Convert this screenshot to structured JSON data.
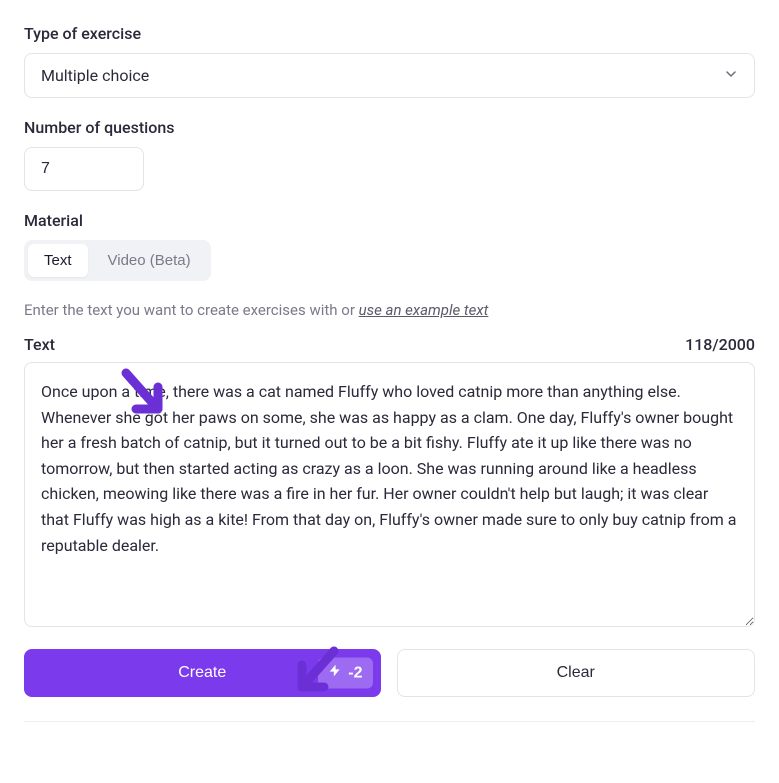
{
  "exercise_type": {
    "label": "Type of exercise",
    "value": "Multiple choice"
  },
  "num_questions": {
    "label": "Number of questions",
    "value": "7"
  },
  "material": {
    "label": "Material",
    "tabs": [
      {
        "label": "Text",
        "active": true
      },
      {
        "label": "Video (Beta)",
        "active": false
      }
    ]
  },
  "hint": {
    "prefix": "Enter the text you want to create exercises with or ",
    "link": "use an example text"
  },
  "text_input": {
    "label": "Text",
    "char_count": "118/2000",
    "value": "Once upon a time, there was a cat named Fluffy who loved catnip more than anything else. Whenever she got her paws on some, she was as happy as a clam. One day, Fluffy's owner bought her a fresh batch of catnip, but it turned out to be a bit fishy. Fluffy ate it up like there was no tomorrow, but then started acting as crazy as a loon. She was running around like a headless chicken, meowing like there was a fire in her fur. Her owner couldn't help but laugh; it was clear that Fluffy was high as a kite! From that day on, Fluffy's owner made sure to only buy catnip from a reputable dealer."
  },
  "buttons": {
    "create": "Create",
    "clear": "Clear",
    "cost": "-2"
  }
}
